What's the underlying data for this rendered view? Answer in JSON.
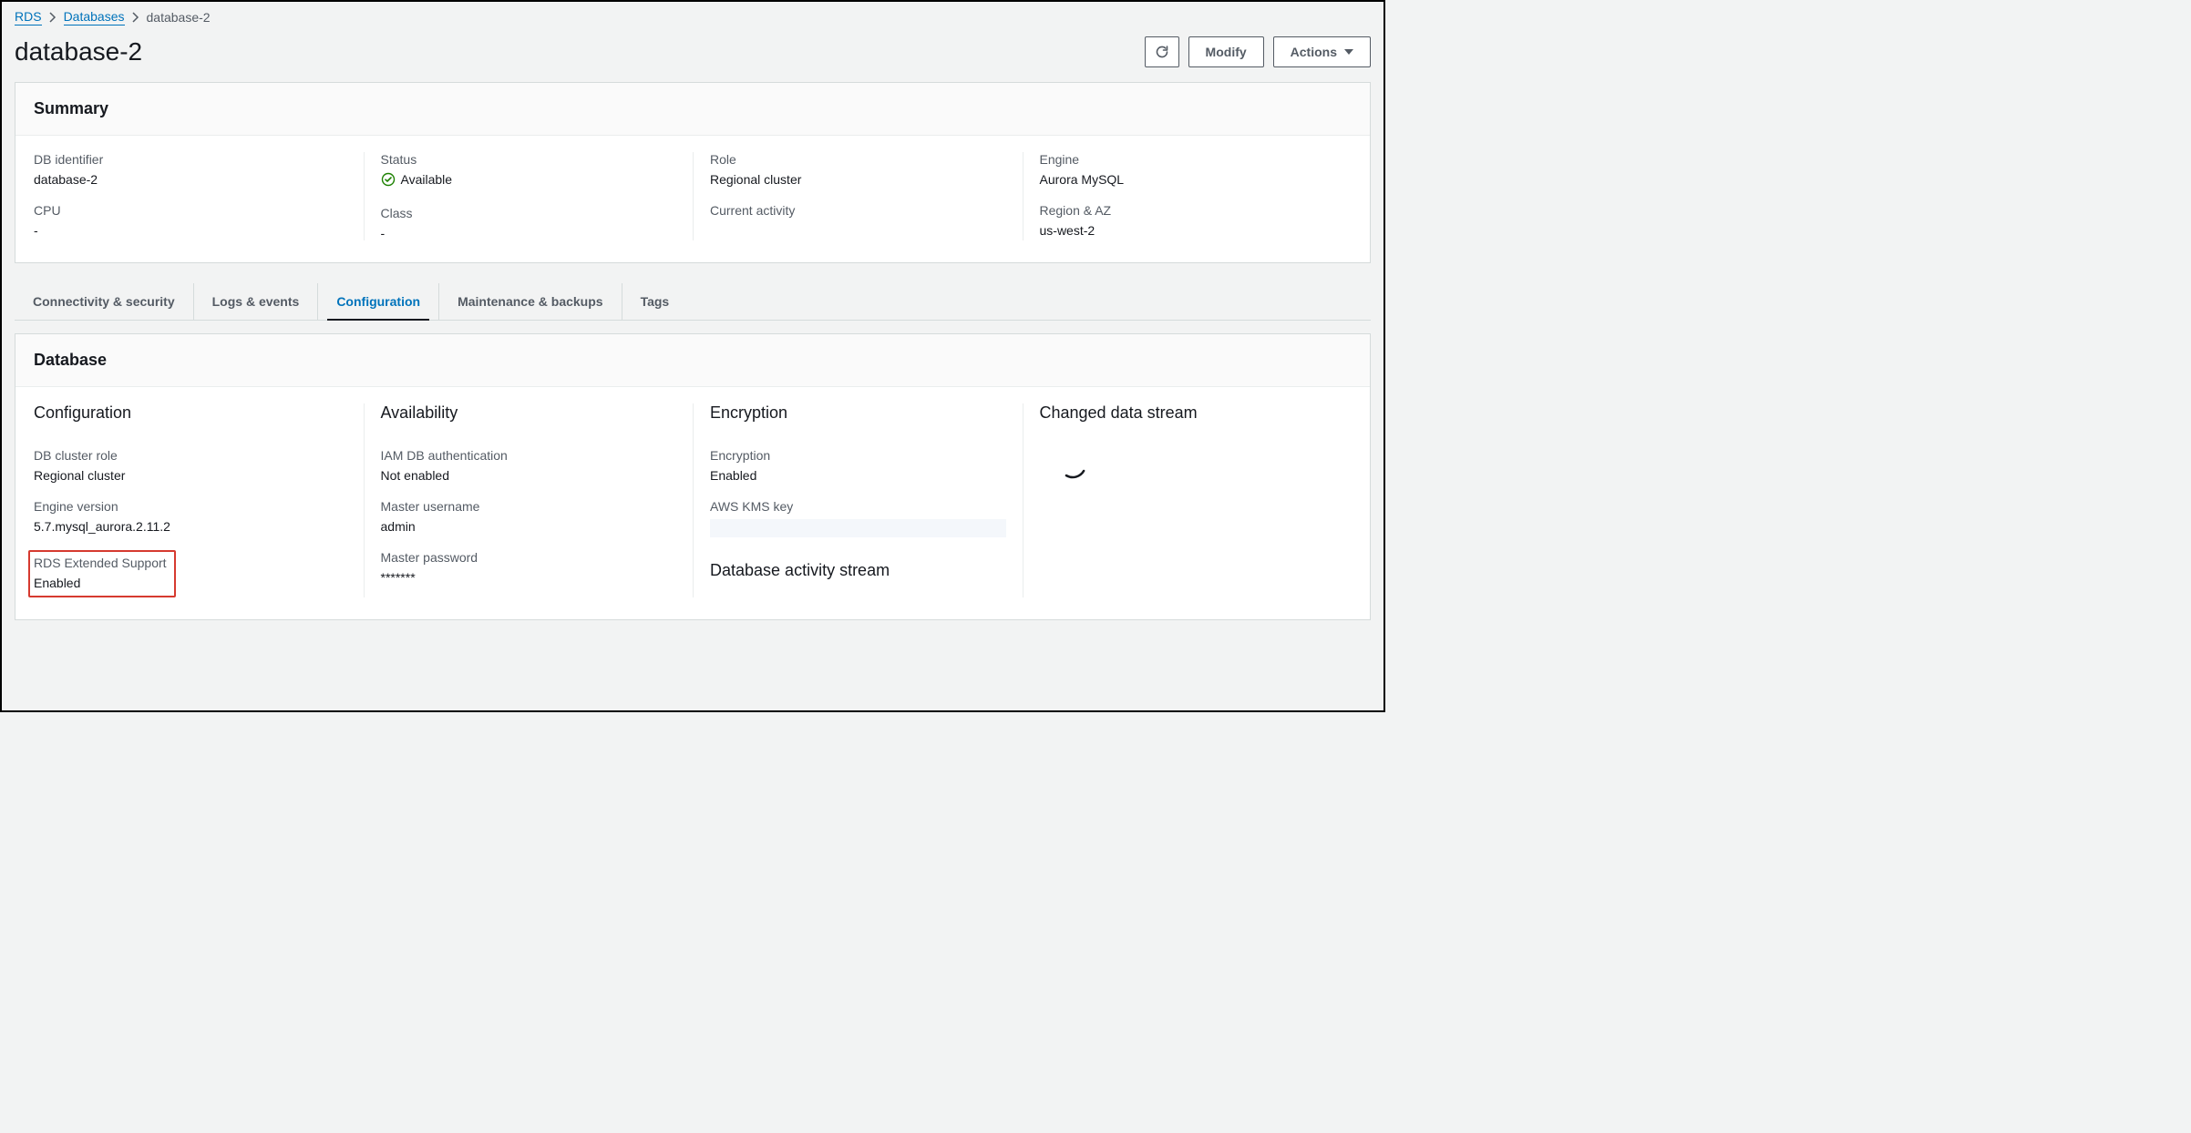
{
  "breadcrumb": {
    "root": "RDS",
    "databases": "Databases",
    "current": "database-2"
  },
  "page_title": "database-2",
  "actions": {
    "modify": "Modify",
    "actions": "Actions"
  },
  "summary": {
    "title": "Summary",
    "db_identifier_label": "DB identifier",
    "db_identifier_value": "database-2",
    "cpu_label": "CPU",
    "cpu_value": "-",
    "status_label": "Status",
    "status_value": "Available",
    "class_label": "Class",
    "class_value": "-",
    "role_label": "Role",
    "role_value": "Regional cluster",
    "current_activity_label": "Current activity",
    "engine_label": "Engine",
    "engine_value": "Aurora MySQL",
    "region_az_label": "Region & AZ",
    "region_az_value": "us-west-2"
  },
  "tabs": {
    "connectivity": "Connectivity & security",
    "logs": "Logs & events",
    "configuration": "Configuration",
    "maintenance": "Maintenance & backups",
    "tags": "Tags"
  },
  "database": {
    "title": "Database",
    "configuration": {
      "heading": "Configuration",
      "db_cluster_role_label": "DB cluster role",
      "db_cluster_role_value": "Regional cluster",
      "engine_version_label": "Engine version",
      "engine_version_value": "5.7.mysql_aurora.2.11.2",
      "rds_extended_support_label": "RDS Extended Support",
      "rds_extended_support_value": "Enabled"
    },
    "availability": {
      "heading": "Availability",
      "iam_auth_label": "IAM DB authentication",
      "iam_auth_value": "Not enabled",
      "master_username_label": "Master username",
      "master_username_value": "admin",
      "master_password_label": "Master password",
      "master_password_value": "*******"
    },
    "encryption": {
      "heading": "Encryption",
      "encryption_label": "Encryption",
      "encryption_value": "Enabled",
      "kms_key_label": "AWS KMS key",
      "activity_heading": "Database activity stream"
    },
    "changed_data_stream": {
      "heading": "Changed data stream"
    }
  }
}
